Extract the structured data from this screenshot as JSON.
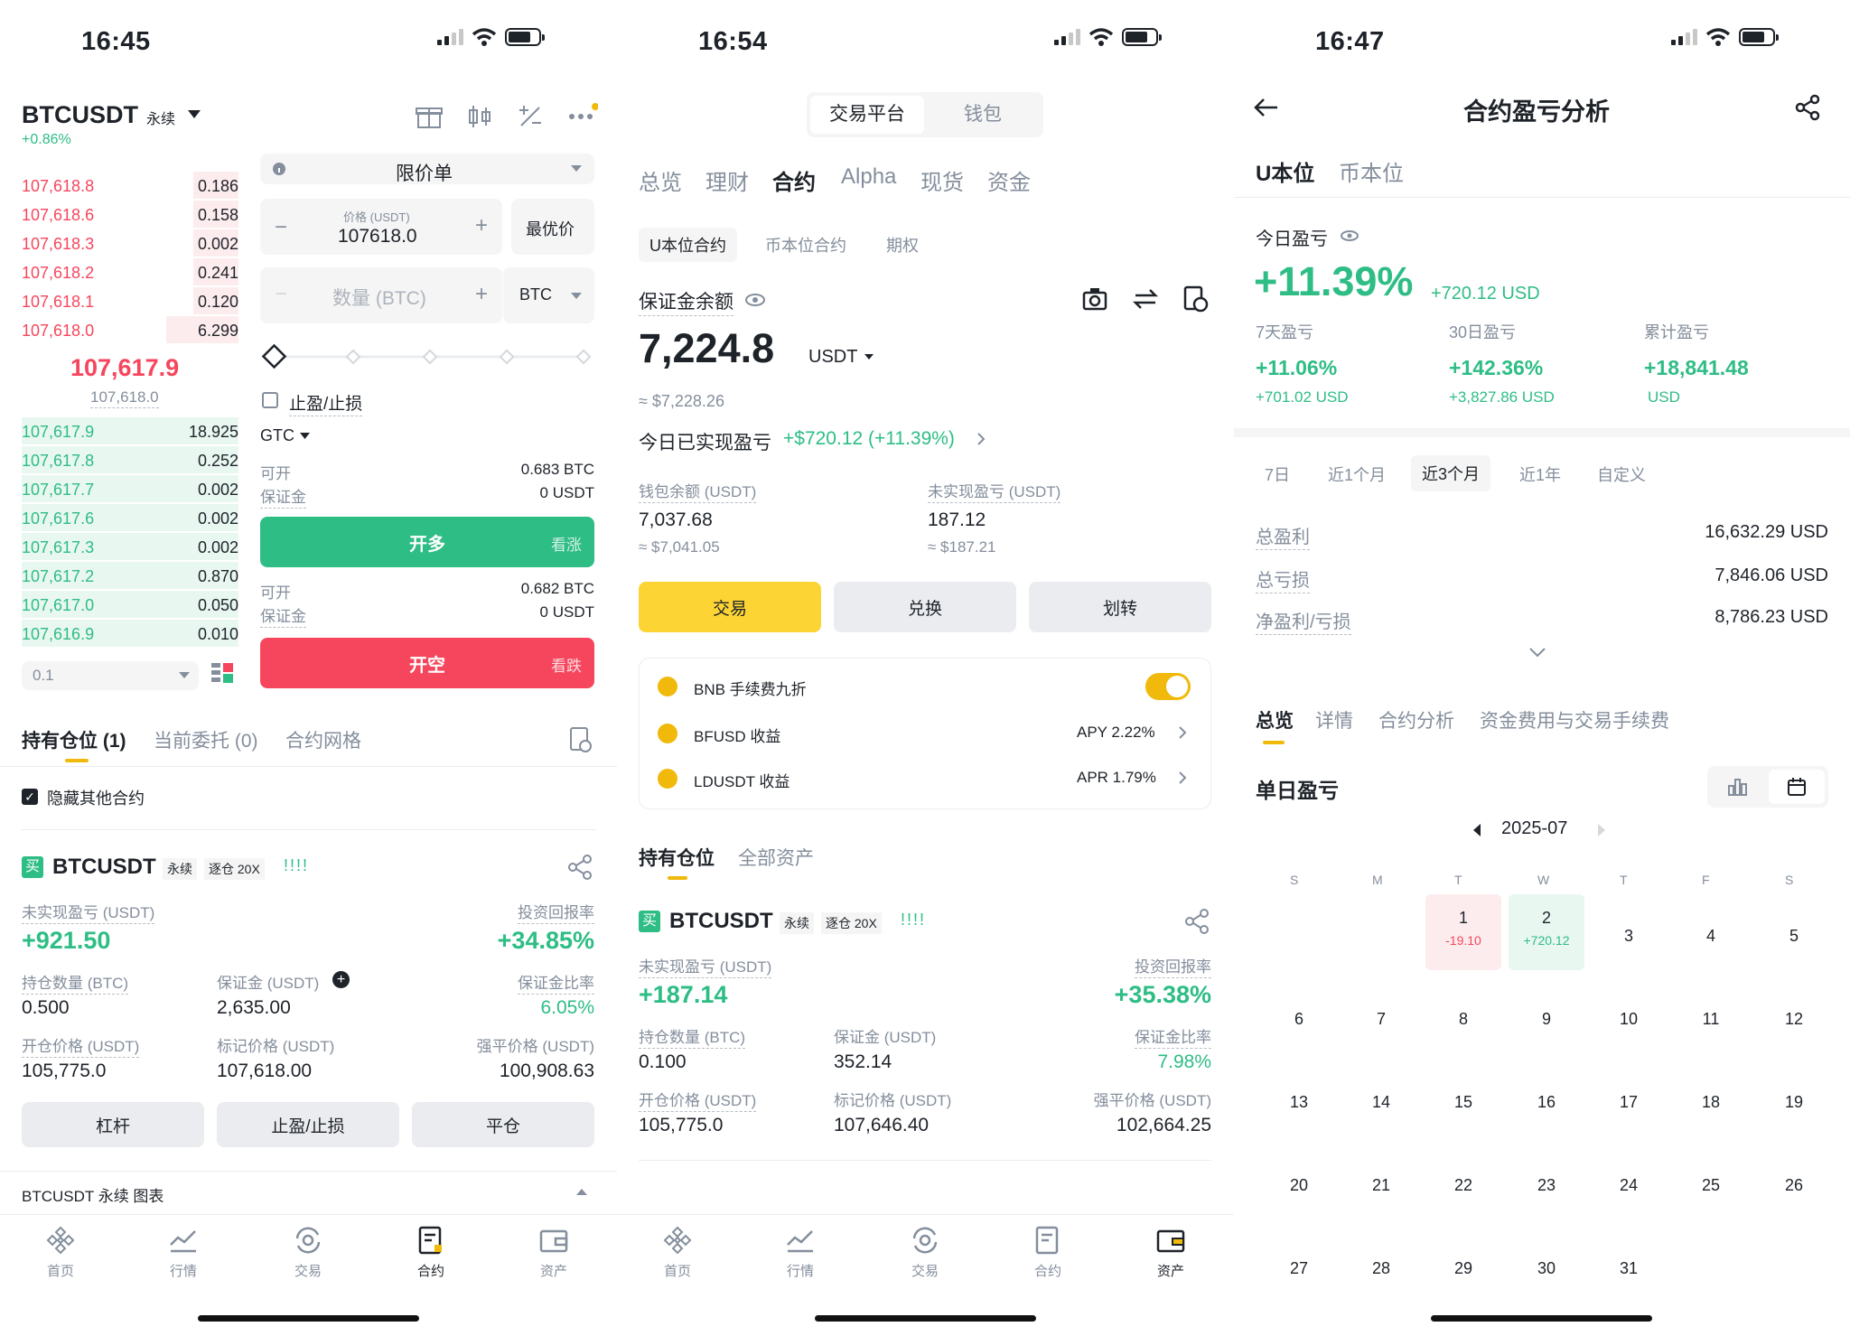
{
  "colors": {
    "green": "#2ebd85",
    "red": "#f6465d",
    "yellow": "#fcd535",
    "gray": "#848e9c"
  },
  "p1": {
    "time": "16:45",
    "symbol": "BTCUSDT",
    "perp": "永续",
    "change": "+0.86%",
    "asks": [
      {
        "p": "107,618.8",
        "q": "0.186"
      },
      {
        "p": "107,618.6",
        "q": "0.158"
      },
      {
        "p": "107,618.3",
        "q": "0.002"
      },
      {
        "p": "107,618.2",
        "q": "0.241"
      },
      {
        "p": "107,618.1",
        "q": "0.120"
      },
      {
        "p": "107,618.0",
        "q": "6.299"
      }
    ],
    "mid": "107,617.9",
    "mark": "107,618.0",
    "bids": [
      {
        "p": "107,617.9",
        "q": "18.925"
      },
      {
        "p": "107,617.8",
        "q": "0.252"
      },
      {
        "p": "107,617.7",
        "q": "0.002"
      },
      {
        "p": "107,617.6",
        "q": "0.002"
      },
      {
        "p": "107,617.3",
        "q": "0.002"
      },
      {
        "p": "107,617.2",
        "q": "0.870"
      },
      {
        "p": "107,617.0",
        "q": "0.050"
      },
      {
        "p": "107,616.9",
        "q": "0.010"
      }
    ],
    "depth_step": "0.1",
    "order_type": "限价单",
    "price_label": "价格 (USDT)",
    "price_value": "107618.0",
    "best_price": "最优价",
    "qty_placeholder": "数量 (BTC)",
    "qty_unit": "BTC",
    "tpsl": "止盈/止损",
    "tif": "GTC",
    "avail": "可开",
    "margin": "保证金",
    "long_avail": "0.683 BTC",
    "long_margin": "0 USDT",
    "long_btn": "开多",
    "long_sub": "看涨",
    "short_avail": "0.682 BTC",
    "short_margin": "0 USDT",
    "short_btn": "开空",
    "short_sub": "看跌",
    "tabs": [
      "持有仓位 (1)",
      "当前委托 (0)",
      "合约网格"
    ],
    "hide_other": "隐藏其他合约",
    "pos": {
      "side": "买",
      "symbol": "BTCUSDT",
      "perp": "永续",
      "mode": "逐仓 20X",
      "bars": "!!!!",
      "upnl_label": "未实现盈亏 (USDT)",
      "upnl": "+921.50",
      "roi_label": "投资回报率",
      "roi": "+34.85%",
      "size_label": "持仓数量 (BTC)",
      "size": "0.500",
      "margin_label": "保证金 (USDT)",
      "margin": "2,635.00",
      "mr_label": "保证金比率",
      "mr": "6.05%",
      "entry_label": "开仓价格 (USDT)",
      "entry": "105,775.0",
      "markp_label": "标记价格 (USDT)",
      "markp": "107,618.00",
      "liq_label": "强平价格 (USDT)",
      "liq": "100,908.63"
    },
    "actions": [
      "杠杆",
      "止盈/止损",
      "平仓"
    ],
    "chart_bar": "BTCUSDT 永续  图表"
  },
  "p2": {
    "time": "16:54",
    "seg": [
      "交易平台",
      "钱包"
    ],
    "tabs": [
      "总览",
      "理财",
      "合约",
      "Alpha",
      "现货",
      "资金"
    ],
    "subtabs": [
      "U本位合约",
      "币本位合约",
      "期权"
    ],
    "bal_label": "保证金余额",
    "bal": "7,224.8",
    "bal_unit": "USDT",
    "bal_usd": "≈ $7,228.26",
    "today_label": "今日已实现盈亏",
    "today_val": "+$720.12 (+11.39%)",
    "wallet_label": "钱包余额 (USDT)",
    "wallet": "7,037.68",
    "wallet_usd": "≈ $7,041.05",
    "upnl_label": "未实现盈亏 (USDT)",
    "upnl": "187.12",
    "upnl_usd": "≈ $187.21",
    "btns": [
      "交易",
      "兑换",
      "划转"
    ],
    "earn": [
      {
        "name": "BNB 手续费九折",
        "val": ""
      },
      {
        "name": "BFUSD 收益",
        "val": "APY 2.22%"
      },
      {
        "name": "LDUSDT 收益",
        "val": "APR 1.79%"
      }
    ],
    "ptabs": [
      "持有仓位",
      "全部资产"
    ],
    "pos": {
      "side": "买",
      "symbol": "BTCUSDT",
      "perp": "永续",
      "mode": "逐仓 20X",
      "bars": "!!!!",
      "upnl_label": "未实现盈亏 (USDT)",
      "upnl": "+187.14",
      "roi_label": "投资回报率",
      "roi": "+35.38%",
      "size_label": "持仓数量 (BTC)",
      "size": "0.100",
      "margin_label": "保证金 (USDT)",
      "margin": "352.14",
      "mr_label": "保证金比率",
      "mr": "7.98%",
      "entry_label": "开仓价格 (USDT)",
      "entry": "105,775.0",
      "markp_label": "标记价格 (USDT)",
      "markp": "107,646.40",
      "liq_label": "强平价格 (USDT)",
      "liq": "102,664.25"
    }
  },
  "p3": {
    "time": "16:47",
    "title": "合约盈亏分析",
    "tabs": [
      "U本位",
      "币本位"
    ],
    "today_label": "今日盈亏",
    "today_pct": "+11.39%",
    "today_usd": "+720.12 USD",
    "stats": [
      {
        "label": "7天盈亏",
        "pct": "+11.06%",
        "usd": "+701.02 USD"
      },
      {
        "label": "30日盈亏",
        "pct": "+142.36%",
        "usd": "+3,827.86 USD"
      },
      {
        "label": "累计盈亏",
        "pct": "+18,841.48",
        "usd": "USD"
      }
    ],
    "ranges": [
      "7日",
      "近1个月",
      "近3个月",
      "近1年",
      "自定义"
    ],
    "totals": [
      {
        "label": "总盈利",
        "val": "16,632.29 USD"
      },
      {
        "label": "总亏损",
        "val": "7,846.06 USD"
      },
      {
        "label": "净盈利/亏损",
        "val": "8,786.23 USD"
      }
    ],
    "subtabs": [
      "总览",
      "详情",
      "合约分析",
      "资金费用与交易手续费"
    ],
    "daily": "单日盈亏",
    "month": "2025-07",
    "weekdays": [
      "S",
      "M",
      "T",
      "W",
      "T",
      "F",
      "S"
    ],
    "day1": "-19.10",
    "day2": "+720.12"
  },
  "nav": [
    "首页",
    "行情",
    "交易",
    "合约",
    "资产"
  ]
}
